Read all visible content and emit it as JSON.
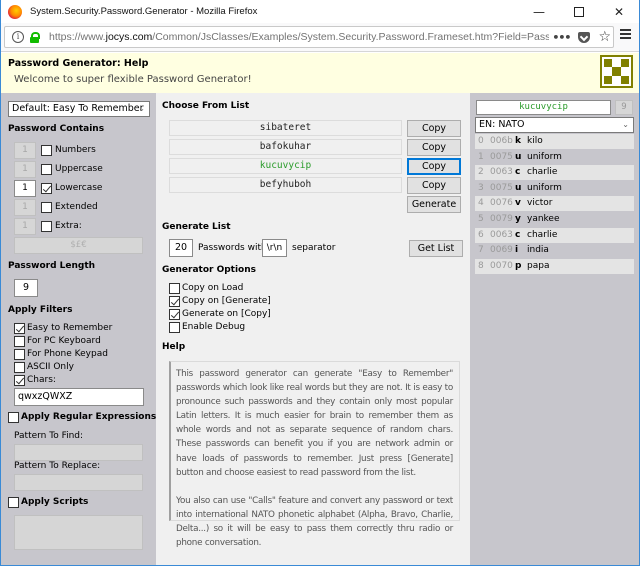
{
  "window": {
    "title": "System.Security.Password.Generator - Mozilla Firefox",
    "controls": [
      "minimize",
      "maximize",
      "close"
    ]
  },
  "browser": {
    "url_prefix": "https://www.",
    "url_domain": "jocys.com",
    "url_rest": "/Common/JsClasses/Examples/System.Security.Password.Frameset.htm?Field=Password",
    "icons": [
      "info-icon",
      "lock-icon",
      "more-icon",
      "pocket-icon",
      "bookmark-star-icon",
      "menu-icon"
    ]
  },
  "header": {
    "title": "Password Generator: Help",
    "subtitle": "Welcome to super flexible Password Generator!",
    "logo_color": "#808000"
  },
  "left": {
    "preset": "Default: Easy To Remember",
    "password_contains_title": "Password Contains",
    "contains": [
      {
        "count": "1",
        "label": "Numbers",
        "checked": false,
        "enabled": false
      },
      {
        "count": "1",
        "label": "Uppercase",
        "checked": false,
        "enabled": false
      },
      {
        "count": "1",
        "label": "Lowercase",
        "checked": true,
        "enabled": true
      },
      {
        "count": "1",
        "label": "Extended",
        "checked": false,
        "enabled": false
      },
      {
        "count": "1",
        "label": "Extra:",
        "checked": false,
        "enabled": false
      }
    ],
    "extra_chars": "$£€",
    "length_title": "Password Length",
    "length": "9",
    "filters_title": "Apply Filters",
    "filters": [
      {
        "label": "Easy to Remember",
        "checked": true
      },
      {
        "label": "For PC Keyboard",
        "checked": false
      },
      {
        "label": "For Phone Keypad",
        "checked": false
      },
      {
        "label": "ASCII Only",
        "checked": false
      },
      {
        "label": "Chars:",
        "checked": true
      }
    ],
    "chars_value": "qwxzQWXZ",
    "regex_title": "Apply Regular Expressions",
    "regex_checked": false,
    "find_label": "Pattern To Find:",
    "find_value": "",
    "replace_label": "Pattern To Replace:",
    "replace_value": "",
    "scripts_title": "Apply Scripts",
    "scripts_checked": false,
    "scripts_value": ""
  },
  "middle": {
    "choose_title": "Choose From List",
    "passwords": [
      {
        "value": "sibateret",
        "highlighted": false
      },
      {
        "value": "bafokuhar",
        "highlighted": false
      },
      {
        "value": "kucuvycip",
        "highlighted": true
      },
      {
        "value": "befyhuboh",
        "highlighted": false
      }
    ],
    "copy_label": "Copy",
    "generate_label": "Generate",
    "generate_list_title": "Generate List",
    "list_count": "20",
    "passwords_with_label": "Passwords with",
    "separator_value": "\\r\\n",
    "separator_label": "separator",
    "get_list_label": "Get List",
    "options_title": "Generator Options",
    "options": [
      {
        "label": "Copy on Load",
        "checked": false
      },
      {
        "label": "Copy on [Generate]",
        "checked": true
      },
      {
        "label": "Generate on [Copy]",
        "checked": true
      },
      {
        "label": "Enable Debug",
        "checked": false
      }
    ],
    "help_title": "Help",
    "help_p1": "This password generator can generate \"Easy to Remember\" passwords which look like real words but they are not. It is easy to pronounce such passwords and they contain only most popular Latin letters. It is much easier for brain to remember them as whole words and not as separate sequence of random chars. These passwords can benefit you if you are network admin or have loads of passwords to remember. Just press [Generate] button and choose easiest to read password from the list.",
    "help_p2": "You also can use \"Calls\" feature and convert any password or text into international NATO phonetic alphabet (Alpha, Bravo, Charlie, Delta...) so it will be easy to pass them correctly thru radio or phone conversation."
  },
  "right": {
    "password": "kucuvycip",
    "length": "9",
    "alphabet": "EN: NATO",
    "rows": [
      {
        "index": "0",
        "code": "006b",
        "char": "k",
        "word": "kilo"
      },
      {
        "index": "1",
        "code": "0075",
        "char": "u",
        "word": "uniform"
      },
      {
        "index": "2",
        "code": "0063",
        "char": "c",
        "word": "charlie"
      },
      {
        "index": "3",
        "code": "0075",
        "char": "u",
        "word": "uniform"
      },
      {
        "index": "4",
        "code": "0076",
        "char": "v",
        "word": "victor"
      },
      {
        "index": "5",
        "code": "0079",
        "char": "y",
        "word": "yankee"
      },
      {
        "index": "6",
        "code": "0063",
        "char": "c",
        "word": "charlie"
      },
      {
        "index": "7",
        "code": "0069",
        "char": "i",
        "word": "india"
      },
      {
        "index": "8",
        "code": "0070",
        "char": "p",
        "word": "papa"
      }
    ]
  }
}
